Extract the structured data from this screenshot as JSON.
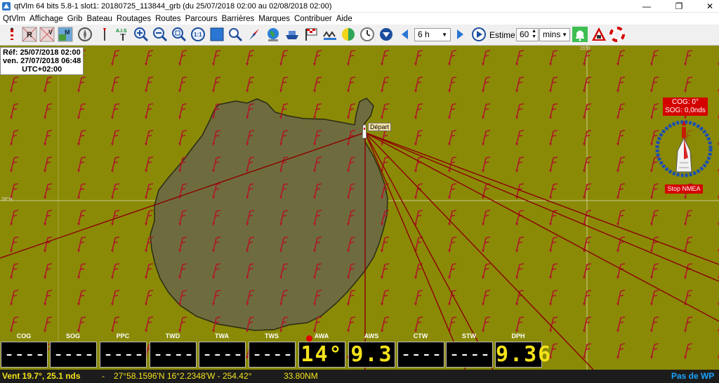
{
  "window": {
    "title": "qtVlm 64 bits 5.8-1 slot1: 20180725_113844_grb (du 25/07/2018 02:00 au 02/08/2018 02:00)",
    "controls": {
      "minimize": "—",
      "maximize": "❐",
      "close": "✕"
    }
  },
  "menu": [
    "QtVlm",
    "Affichage",
    "Grib",
    "Bateau",
    "Routages",
    "Routes",
    "Parcours",
    "Barrières",
    "Marques",
    "Contribuer",
    "Aide"
  ],
  "toolbar": {
    "icons": [
      "lighthouse-icon",
      "map-r-icon",
      "map-nav-v-icon",
      "map-m-icon",
      "compass-rose-icon",
      "barb-icon",
      "ais-icon",
      "zoom-in-icon",
      "zoom-out-icon",
      "zoom-fit-icon",
      "zoom-11-icon",
      "square-icon",
      "magnifier-icon",
      "compass-needle-icon",
      "globe-icon",
      "ship-icon",
      "flag-icon",
      "tide-icon",
      "sun-icon",
      "clock-icon",
      "download-icon",
      "prev-icon",
      "next-icon",
      "play-icon"
    ],
    "interval": "6 h",
    "estime_label": "Estime",
    "estime_value": "60",
    "estime_unit": "mins",
    "ais_text": "A.I.S",
    "map_letters": {
      "r": "R",
      "v": "V",
      "m": "M",
      "zoom_11": "1:1"
    }
  },
  "map": {
    "ref_date": "Réf: 25/07/2018 02:00",
    "now_date": "ven. 27/07/2018 06:48",
    "timezone": "UTC+02:00",
    "grid_lat_label": "28°N",
    "grid_lon_label": "15°0",
    "depart_label": "Départ",
    "cog": "COG: 0°",
    "sog": "SOG: 0,0nds",
    "stop_nmea": "Stop NMEA",
    "colors": {
      "sea": "#8a8a06",
      "land": "#6e6c3e",
      "arrow": "#b0162a",
      "route": "#8b0000"
    }
  },
  "instruments": [
    {
      "label": "COG",
      "value": "----",
      "active": false
    },
    {
      "label": "SOG",
      "value": "----",
      "active": false
    },
    {
      "label": "PPC",
      "value": "----",
      "active": false
    },
    {
      "label": "TWD",
      "value": "----",
      "active": false
    },
    {
      "label": "TWA",
      "value": "----",
      "active": false
    },
    {
      "label": "TWS",
      "value": "----",
      "active": false
    },
    {
      "label": "AWA",
      "value": "14°",
      "active": true
    },
    {
      "label": "AWS",
      "value": "9.3",
      "active": true
    },
    {
      "label": "CTW",
      "value": "----",
      "active": false
    },
    {
      "label": "STW",
      "value": "----",
      "active": false
    },
    {
      "label": "DPH",
      "value": "9.36",
      "active": true
    }
  ],
  "status": {
    "wind": "Vent 19.7°, 25.1 nds",
    "separator": "-",
    "coord": "27°58.1596'N 16°2.2348'W - 254.42°",
    "dist": "33.80NM",
    "wp": "Pas de WP"
  }
}
